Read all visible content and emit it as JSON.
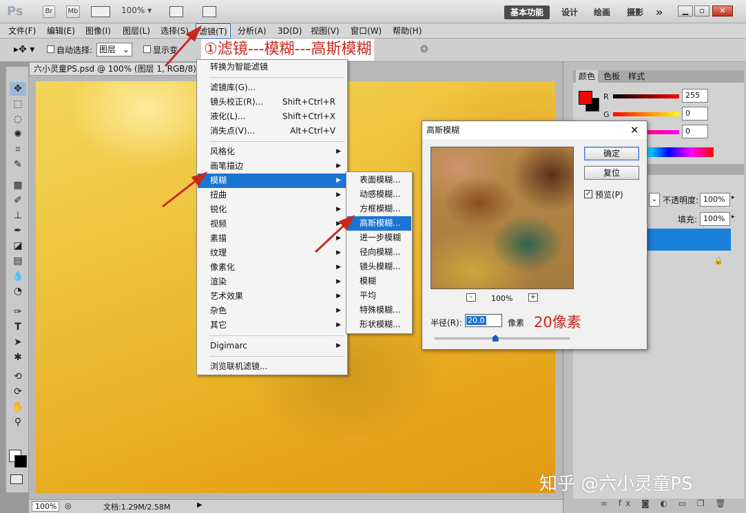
{
  "titlebar": {
    "logo": "Ps",
    "bridge_btn": "Br",
    "minibridge_btn": "Mb",
    "zoom": "100%",
    "workspaces": [
      "基本功能",
      "设计",
      "绘画",
      "摄影"
    ],
    "more": "»"
  },
  "menubar": {
    "items": [
      "文件(F)",
      "编辑(E)",
      "图像(I)",
      "图层(L)",
      "选择(S)",
      "滤镜(T)",
      "分析(A)",
      "3D(D)",
      "视图(V)",
      "窗口(W)",
      "帮助(H)"
    ]
  },
  "options": {
    "auto_select_label": "自动选择:",
    "auto_select_value": "图层",
    "show_transform_label": "显示变"
  },
  "document": {
    "tab_title": "六小灵童PS.psd @ 100% (图层 1, RGB/8) *"
  },
  "status": {
    "zoom": "100%",
    "doc_size": "文档:1.29M/2.58M"
  },
  "filter_menu": {
    "top_item": "转换为智能滤镜",
    "group1": [
      {
        "label": "滤镜库(G)...",
        "shortcut": ""
      },
      {
        "label": "镜头校正(R)...",
        "shortcut": "Shift+Ctrl+R"
      },
      {
        "label": "液化(L)...",
        "shortcut": "Shift+Ctrl+X"
      },
      {
        "label": "消失点(V)...",
        "shortcut": "Alt+Ctrl+V"
      }
    ],
    "group2": [
      "风格化",
      "画笔描边",
      "模糊",
      "扭曲",
      "锐化",
      "视频",
      "素描",
      "纹理",
      "像素化",
      "渲染",
      "艺术效果",
      "杂色",
      "其它"
    ],
    "digimarc": "Digimarc",
    "browse": "浏览联机滤镜..."
  },
  "blur_menu": {
    "items": [
      "表面模糊...",
      "动感模糊...",
      "方框模糊...",
      "高斯模糊...",
      "进一步模糊",
      "径向模糊...",
      "镜头模糊...",
      "模糊",
      "平均",
      "特殊模糊...",
      "形状模糊..."
    ]
  },
  "gauss_dialog": {
    "title": "高斯模糊",
    "ok": "确定",
    "reset": "复位",
    "preview_label": "预览(P)",
    "zoom": "100%",
    "zoom_minus": "-",
    "zoom_plus": "+",
    "radius_label": "半径(R):",
    "radius_value": "20.0",
    "unit": "像素",
    "radius_slider_fraction": 0.45
  },
  "color_panel": {
    "tabs": [
      "颜色",
      "色板",
      "样式"
    ],
    "r_label": "R",
    "g_label": "G",
    "r_value": "255",
    "g_value": "0",
    "b_value": "0",
    "fg_color": "#ff0000"
  },
  "layers_panel": {
    "opacity_label": "不透明度:",
    "opacity_value": "100%",
    "fill_label": "填充:",
    "fill_value": "100%"
  },
  "annotations": {
    "step": "①滤镜---模糊---高斯模糊",
    "radius_note": "20像素",
    "watermark": "知乎 @六小灵童PS"
  }
}
